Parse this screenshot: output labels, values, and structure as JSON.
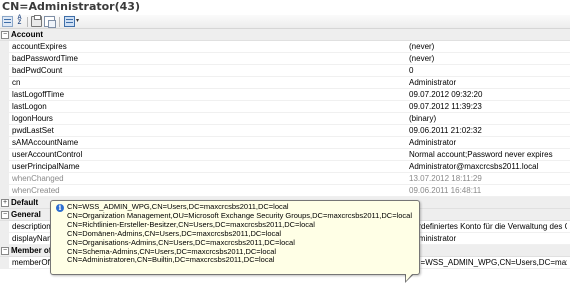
{
  "title": "CN=Administrator(43)",
  "toolbar": {
    "buttons": [
      "categorized-icon",
      "alphabetical-icon",
      "print-icon",
      "copy-icon",
      "property-pages-icon",
      "dropdown-arrow-icon"
    ]
  },
  "categories": {
    "account": "Account",
    "default": "Default",
    "general": "General",
    "member_of": "Member of"
  },
  "account_rows": [
    {
      "name": "accountExpires",
      "value": "(never)"
    },
    {
      "name": "badPasswordTime",
      "value": "(never)"
    },
    {
      "name": "badPwdCount",
      "value": "0"
    },
    {
      "name": "cn",
      "value": "Administrator"
    },
    {
      "name": "lastLogoffTime",
      "value": "09.07.2012 09:32:20"
    },
    {
      "name": "lastLogon",
      "value": "09.07.2012 11:39:23"
    },
    {
      "name": "logonHours",
      "value": "(binary)"
    },
    {
      "name": "pwdLastSet",
      "value": "09.06.2011 21:02:32"
    },
    {
      "name": "sAMAccountName",
      "value": "Administrator"
    },
    {
      "name": "userAccountControl",
      "value": "Normal account;Password never expires"
    },
    {
      "name": "userPrincipalName",
      "value": "Administrator@maxcrcsbs2011.local"
    },
    {
      "name": "whenChanged",
      "value": "13.07.2012 18:11:29"
    },
    {
      "name": "whenCreated",
      "value": "09.06.2011 16:48:11"
    }
  ],
  "general_rows": [
    {
      "name": "description",
      "value": "Vordefiniertes Konto für die Verwaltung des C"
    },
    {
      "name": "displayName",
      "value": "Administrator"
    }
  ],
  "member_of_rows": [
    {
      "name": "memberOf",
      "value": "CN=WSS_ADMIN_WPG,CN=Users,DC=maxcrcsb"
    }
  ],
  "tooltip": {
    "lines": [
      "CN=WSS_ADMIN_WPG,CN=Users,DC=maxcrcsbs2011,DC=local",
      "CN=Organization Management,OU=Microsoft Exchange Security Groups,DC=maxcrcsbs2011,DC=local",
      "CN=Richtlinien-Ersteller-Besitzer,CN=Users,DC=maxcrcsbs2011,DC=local",
      "CN=Domänen-Admins,CN=Users,DC=maxcrcsbs2011,DC=local",
      "CN=Organisations-Admins,CN=Users,DC=maxcrcsbs2011,DC=local",
      "CN=Schema-Admins,CN=Users,DC=maxcrcsbs2011,DC=local",
      "CN=Administratoren,CN=Builtin,DC=maxcrcsbs2011,DC=local"
    ]
  },
  "colors": {
    "tooltip_bg": "#ffffe6",
    "category_bg": "#eeeeee",
    "info_icon": "#2d6fd1"
  }
}
